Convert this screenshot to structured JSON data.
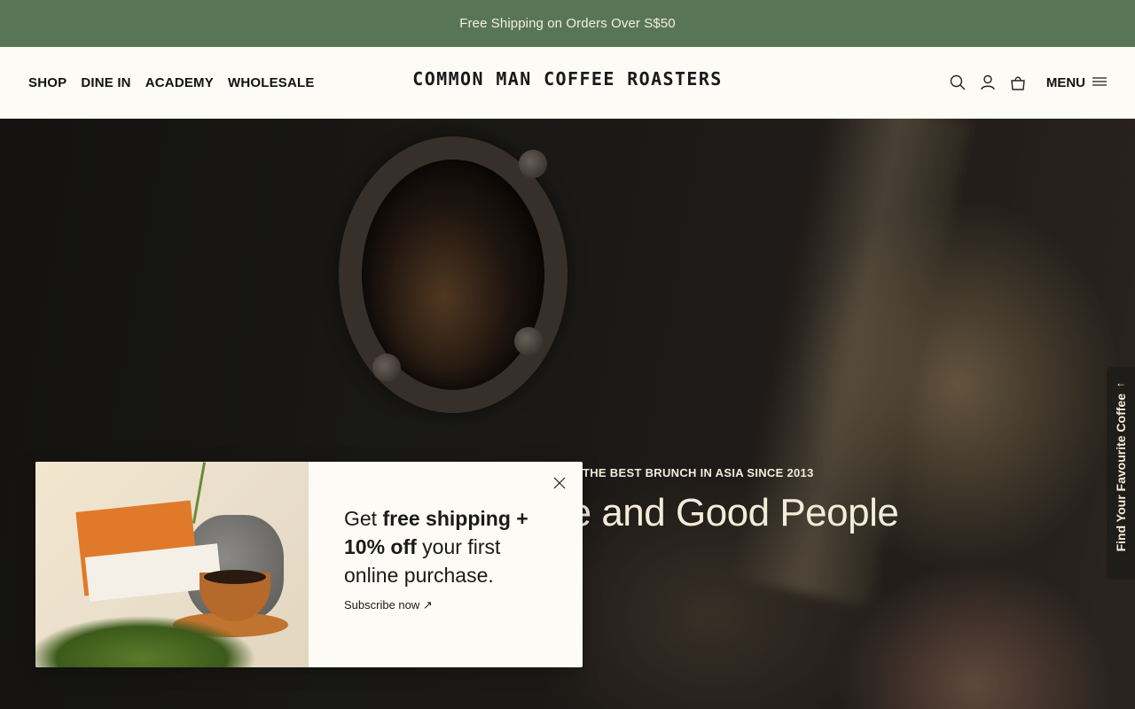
{
  "announcement": {
    "text": "Free Shipping on Orders Over S$50"
  },
  "header": {
    "nav": [
      {
        "label": "SHOP"
      },
      {
        "label": "DINE IN"
      },
      {
        "label": "ACADEMY"
      },
      {
        "label": "WHOLESALE"
      }
    ],
    "logo": "COMMON MAN COFFEE ROASTERS",
    "icons": [
      "search-icon",
      "account-icon",
      "cart-icon"
    ],
    "menu_label": "MENU"
  },
  "hero": {
    "eyebrow": "THE BEST BRUNCH IN ASIA SINCE 2013",
    "title_visible": "e and Good People"
  },
  "side_tab": {
    "label": "Find Your Favourite Coffee"
  },
  "popup": {
    "headline_prefix": "Get ",
    "headline_bold": "free shipping + 10% off",
    "headline_suffix": " your first online purchase.",
    "link_label": "Subscribe now ↗"
  },
  "colors": {
    "announcement_bg": "#587655",
    "header_bg": "#fcfbf5",
    "popup_bg": "#fcfbf5",
    "hero_text": "#f3ecd9"
  }
}
